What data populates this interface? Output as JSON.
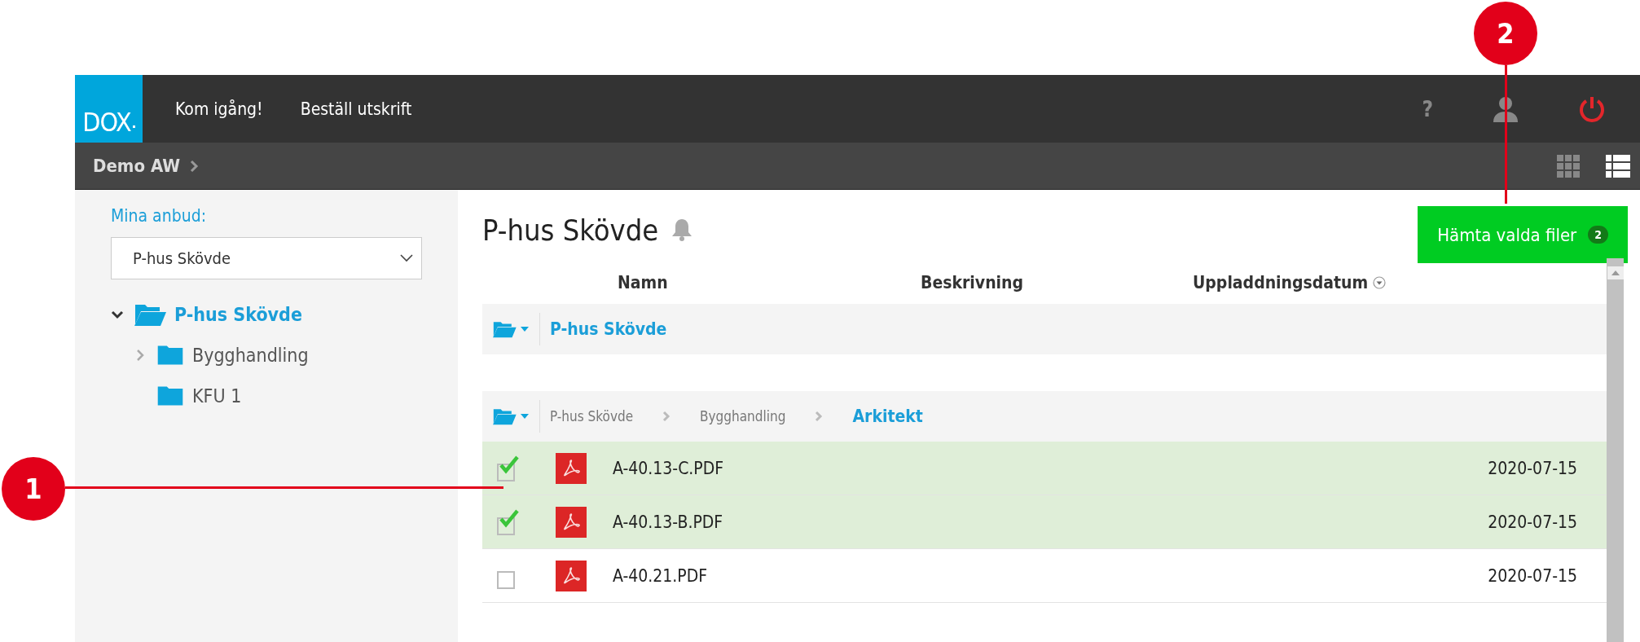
{
  "topbar": {
    "logo": "DOX",
    "nav": [
      {
        "label": "Kom igång!"
      },
      {
        "label": "Beställ utskrift"
      }
    ],
    "help": "?"
  },
  "breadcrumb": {
    "label": "Demo AW"
  },
  "view_modes": [
    {
      "kind": "grid",
      "selected": false
    },
    {
      "kind": "list",
      "selected": true
    }
  ],
  "sidebar": {
    "heading": "Mina anbud:",
    "project_select": {
      "value": "P-hus Skövde"
    },
    "tree": [
      {
        "label": "P-hus Skövde",
        "expandable": true,
        "expanded": true,
        "selected": true,
        "children": [
          {
            "label": "Bygghandling",
            "expandable": true,
            "expanded": false,
            "selected": false
          },
          {
            "label": "KFU 1",
            "expandable": false,
            "expanded": false,
            "selected": false
          }
        ]
      }
    ]
  },
  "page": {
    "title": "P-hus Skövde",
    "download_button": {
      "label": "Hämta valda filer",
      "count": "2"
    }
  },
  "table": {
    "columns": [
      {
        "label": "Namn",
        "sorted": false
      },
      {
        "label": "Beskrivning",
        "sorted": false
      },
      {
        "label": "Uppladdningsdatum",
        "sorted": true
      }
    ],
    "groups": [
      {
        "current": "P-hus Skövde"
      },
      {
        "path": [
          "P-hus Skövde",
          "Bygghandling"
        ],
        "current": "Arkitekt",
        "files": [
          {
            "name": "A-40.13-C.PDF",
            "date": "2020-07-15",
            "checked": true
          },
          {
            "name": "A-40.13-B.PDF",
            "date": "2020-07-15",
            "checked": true
          },
          {
            "name": "A-40.21.PDF",
            "date": "2020-07-15",
            "checked": false
          }
        ]
      }
    ]
  },
  "callouts": [
    {
      "number": "1"
    },
    {
      "number": "2"
    }
  ]
}
